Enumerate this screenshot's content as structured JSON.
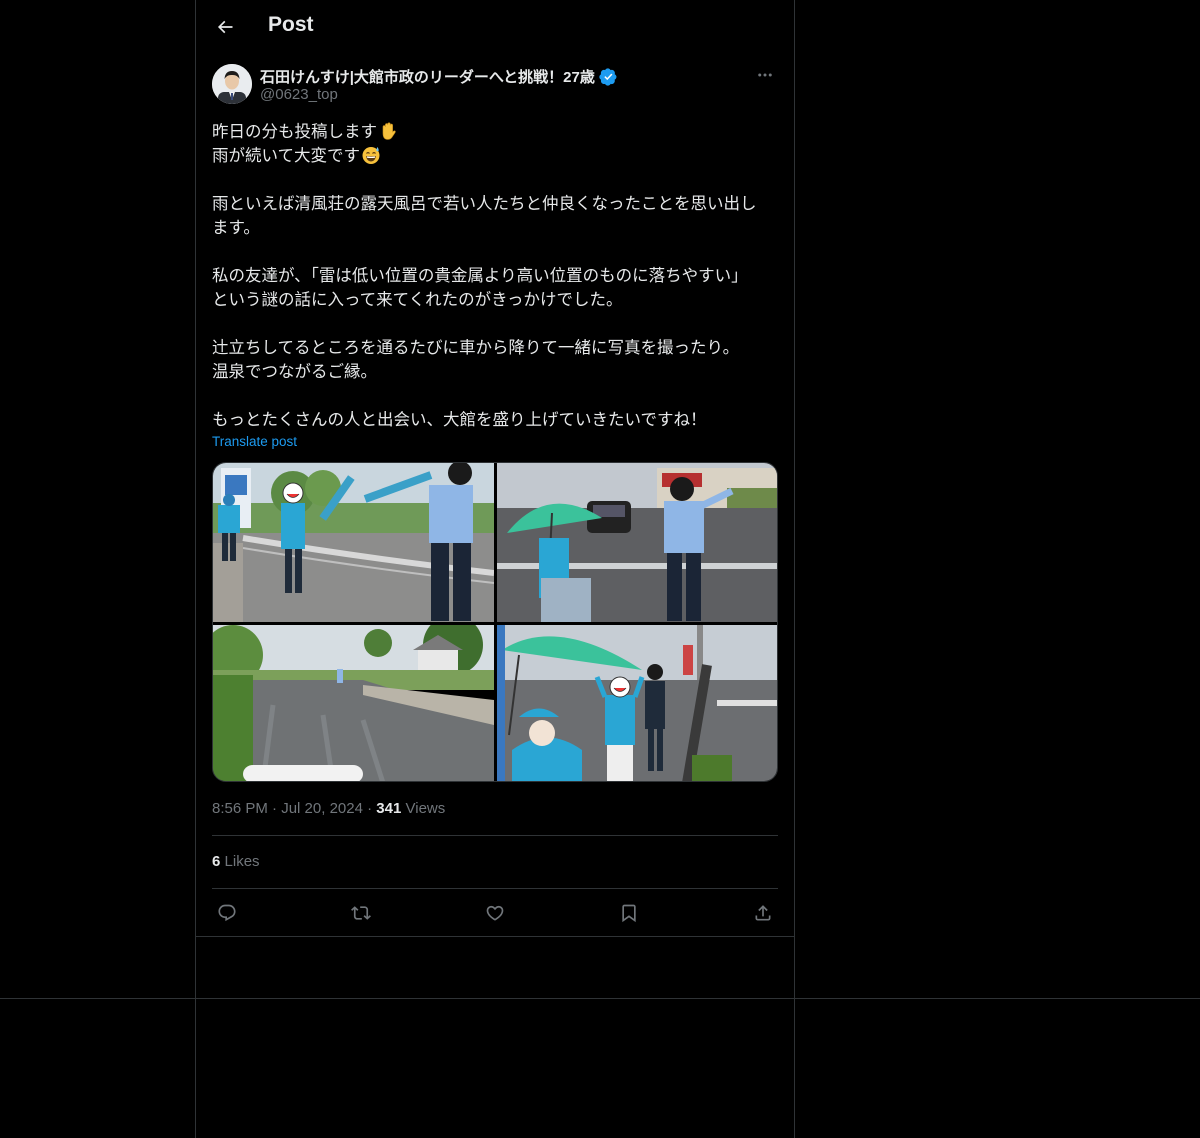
{
  "header": {
    "title": "Post"
  },
  "author": {
    "display_name": "石田けんすけ|大館市政のリーダーへと挑戦！27歳",
    "handle": "@0623_top",
    "verified_color": "#1d9bf0"
  },
  "post": {
    "lines": [
      "昨日の分も投稿します",
      "雨が続いて大変です",
      "雨といえば清風荘の露天風呂で若い人たちと仲良くなったことを思い出し",
      "ます。",
      "私の友達が、「雷は低い位置の貴金属より高い位置のものに落ちやすい」",
      "という謎の話に入って来てくれたのがきっかけでした。",
      "辻立ちしてるところを通るたびに車から降りて一緒に写真を撮ったり。",
      "温泉でつながるご縁。",
      "もっとたくさんの人と出会い、大館を盛り上げていきたいですね！"
    ],
    "translate_label": "Translate post"
  },
  "meta": {
    "time": "8:56 PM",
    "dot": "·",
    "date": "Jul 20, 2024",
    "views_count": "341",
    "views_label": "Views"
  },
  "engagement": {
    "likes_count": "6",
    "likes_label": "Likes"
  },
  "colors": {
    "background": "#000000",
    "text": "#e7e9ea",
    "muted": "#71767b",
    "accent": "#1d9bf0",
    "border": "#2f3336"
  },
  "icons": [
    "back-arrow-icon",
    "verified-badge-icon",
    "more-icon",
    "reply-icon",
    "retweet-icon",
    "like-icon",
    "bookmark-icon",
    "share-icon"
  ]
}
